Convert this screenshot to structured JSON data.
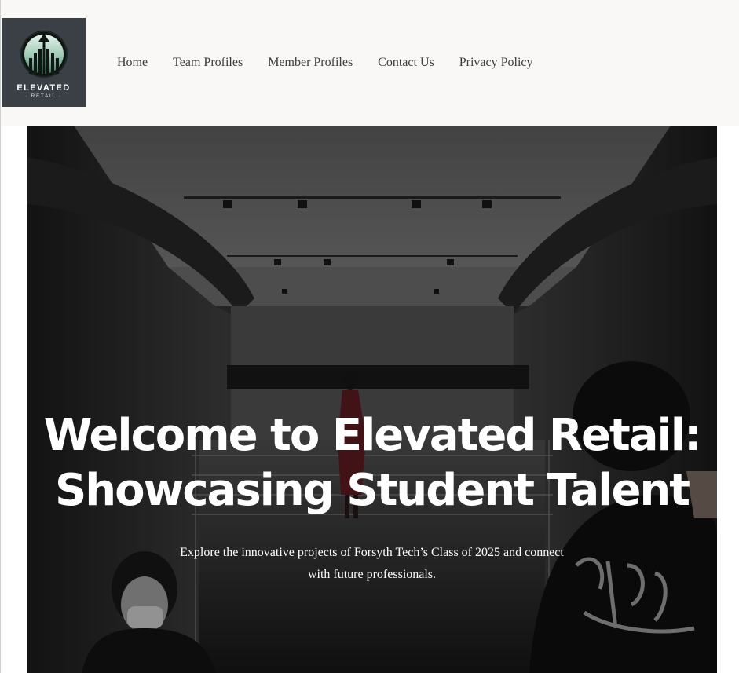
{
  "logo": {
    "word": "ELEVATED",
    "sub": "· RETAIL ·",
    "icon": "rising-arrow-logo-icon",
    "colors": {
      "bg": "#3b4047",
      "accent": "#a9d3c0"
    }
  },
  "nav": {
    "items": [
      {
        "label": "Home"
      },
      {
        "label": "Team Profiles"
      },
      {
        "label": "Member Profiles"
      },
      {
        "label": "Contact Us"
      },
      {
        "label": "Privacy Policy"
      }
    ]
  },
  "hero": {
    "title_line1": "Welcome to Elevated Retail:",
    "title_line2": "Showcasing Student Talent",
    "subtitle": "Explore the innovative projects of Forsyth Tech’s Class of 2025 and connect with future professionals."
  }
}
